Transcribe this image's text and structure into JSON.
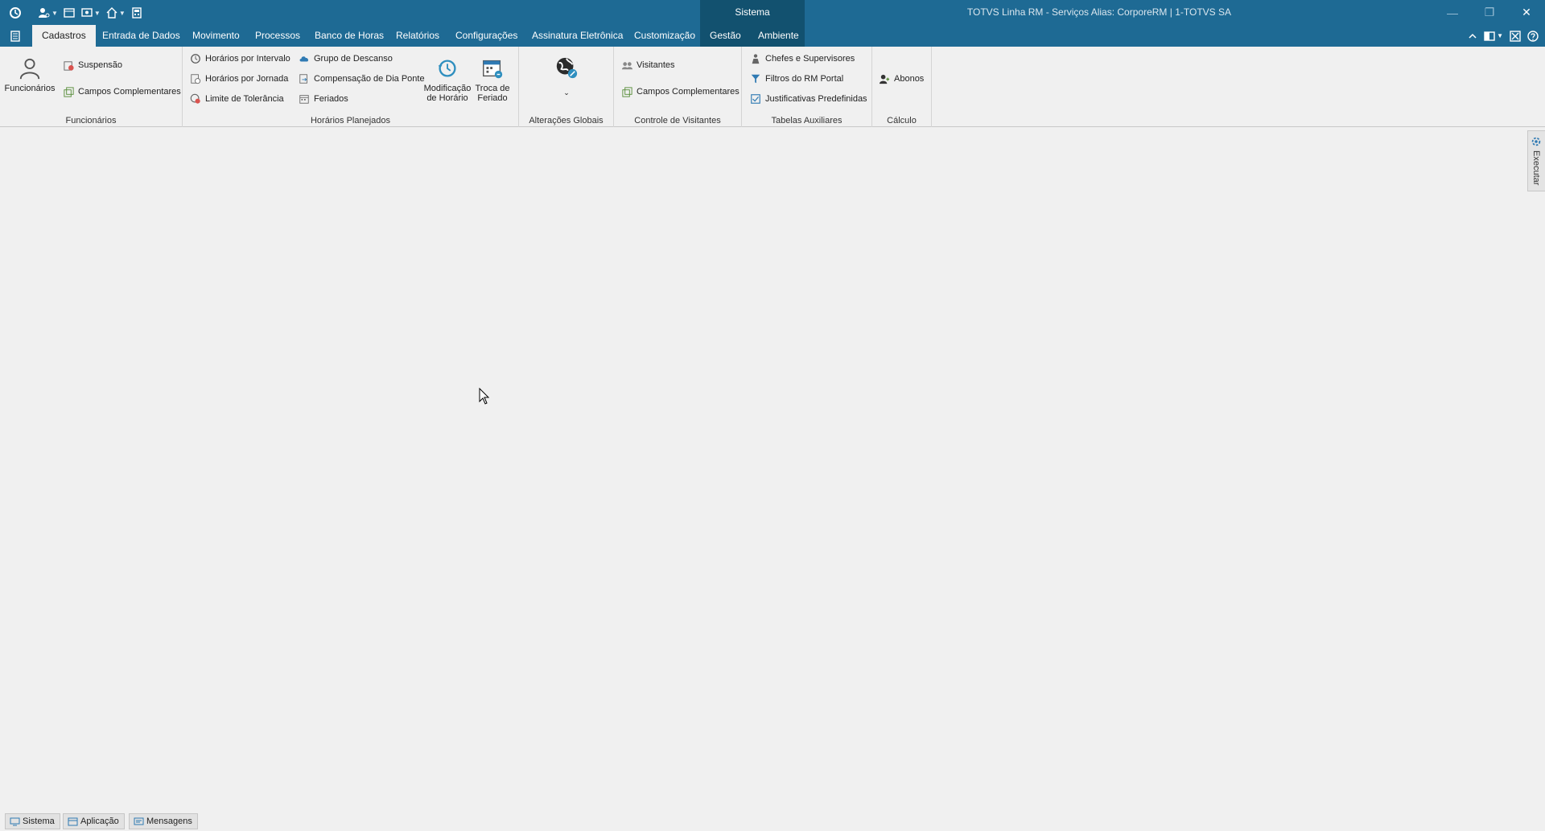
{
  "titlebar": {
    "context_title": "Sistema",
    "window_title": "TOTVS Linha RM - Serviços  Alias: CorporeRM | 1-TOTVS SA",
    "controls": {
      "minimize": "—",
      "restore": "❐",
      "close": "✕"
    }
  },
  "tabs": {
    "items": [
      {
        "label": "Cadastros"
      },
      {
        "label": "Entrada de Dados"
      },
      {
        "label": "Movimento"
      },
      {
        "label": "Processos"
      },
      {
        "label": "Banco de Horas"
      },
      {
        "label": "Relatórios"
      },
      {
        "label": "Configurações"
      },
      {
        "label": "Assinatura Eletrônica"
      },
      {
        "label": "Customização"
      },
      {
        "label": "Gestão"
      },
      {
        "label": "Ambiente"
      }
    ],
    "active": "Cadastros"
  },
  "ribbon": {
    "funcionarios": {
      "label": "Funcionários",
      "large_label": "Funcionários",
      "suspensao": "Suspensão",
      "campos": "Campos Complementares"
    },
    "horarios": {
      "label": "Horários Planejados",
      "horarios_intervalo": "Horários por Intervalo",
      "horarios_jornada": "Horários por Jornada",
      "limite_tolerancia": "Limite de Tolerância",
      "grupo_descanso": "Grupo de Descanso",
      "compensacao": "Compensação de Dia Ponte",
      "feriados": "Feriados",
      "modificacao_line1": "Modificação",
      "modificacao_line2": "de Horário",
      "troca_line1": "Troca de",
      "troca_line2": "Feriado"
    },
    "alteracoes": {
      "label": "Alterações Globais"
    },
    "visitantes": {
      "label": "Controle de Visitantes",
      "visitantes": "Visitantes",
      "campos": "Campos Complementares"
    },
    "tabelas": {
      "label": "Tabelas Auxiliares",
      "chefes": "Chefes e Supervisores",
      "filtros": "Filtros do RM Portal",
      "justificativas": "Justificativas Predefinidas"
    },
    "calculo": {
      "label": "Cálculo",
      "abonos": "Abonos"
    }
  },
  "side_panel": {
    "label": "Executar"
  },
  "statusbar": {
    "tabs": [
      {
        "label": "Sistema"
      },
      {
        "label": "Aplicação"
      },
      {
        "label": "Mensagens"
      }
    ]
  },
  "colors": {
    "titlebar": "#1e6a94",
    "context_tab": "#12516f",
    "ribbon_bg": "#f0f0f0",
    "workspace": "#f0f0f0"
  }
}
